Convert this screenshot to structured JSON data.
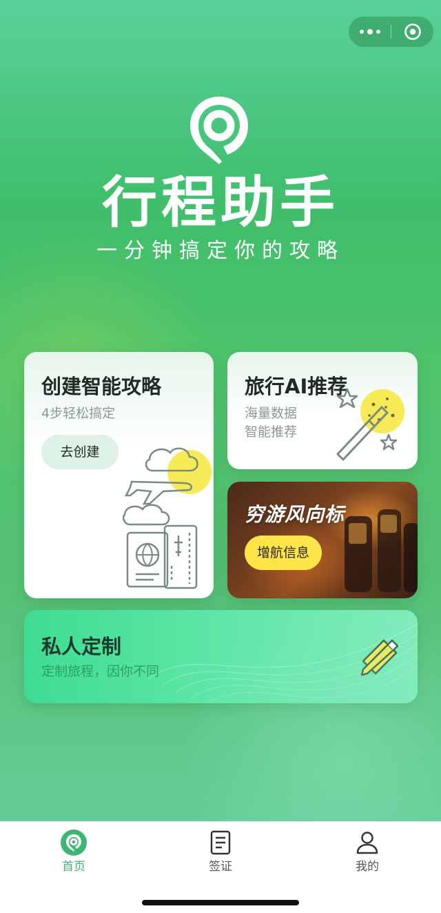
{
  "app": {
    "title": "行程助手",
    "slogan": "一分钟搞定你的攻略"
  },
  "capsule": {
    "more_icon": "more-dots-icon",
    "close_icon": "mini-program-close-icon"
  },
  "cards": {
    "create": {
      "title": "创建智能攻略",
      "subtitle": "4步轻松搞定",
      "button": "去创建",
      "illustration": "travel-illustration"
    },
    "ai": {
      "title": "旅行AI推荐",
      "line1": "海量数据",
      "line2": "智能推荐",
      "illustration": "magic-wand-icon"
    },
    "wind": {
      "title": "穷游风向标",
      "button": "增航信息"
    },
    "custom": {
      "title": "私人定制",
      "subtitle": "定制旅程，因你不同",
      "illustration": "pencil-ruler-icon"
    }
  },
  "tabbar": {
    "items": [
      {
        "label": "首页",
        "icon": "home-pin-icon",
        "active": true
      },
      {
        "label": "签证",
        "icon": "document-icon",
        "active": false
      },
      {
        "label": "我的",
        "icon": "user-icon",
        "active": false
      }
    ]
  },
  "colors": {
    "brand_green": "#3fb573",
    "accent_yellow": "#ffe54a"
  }
}
